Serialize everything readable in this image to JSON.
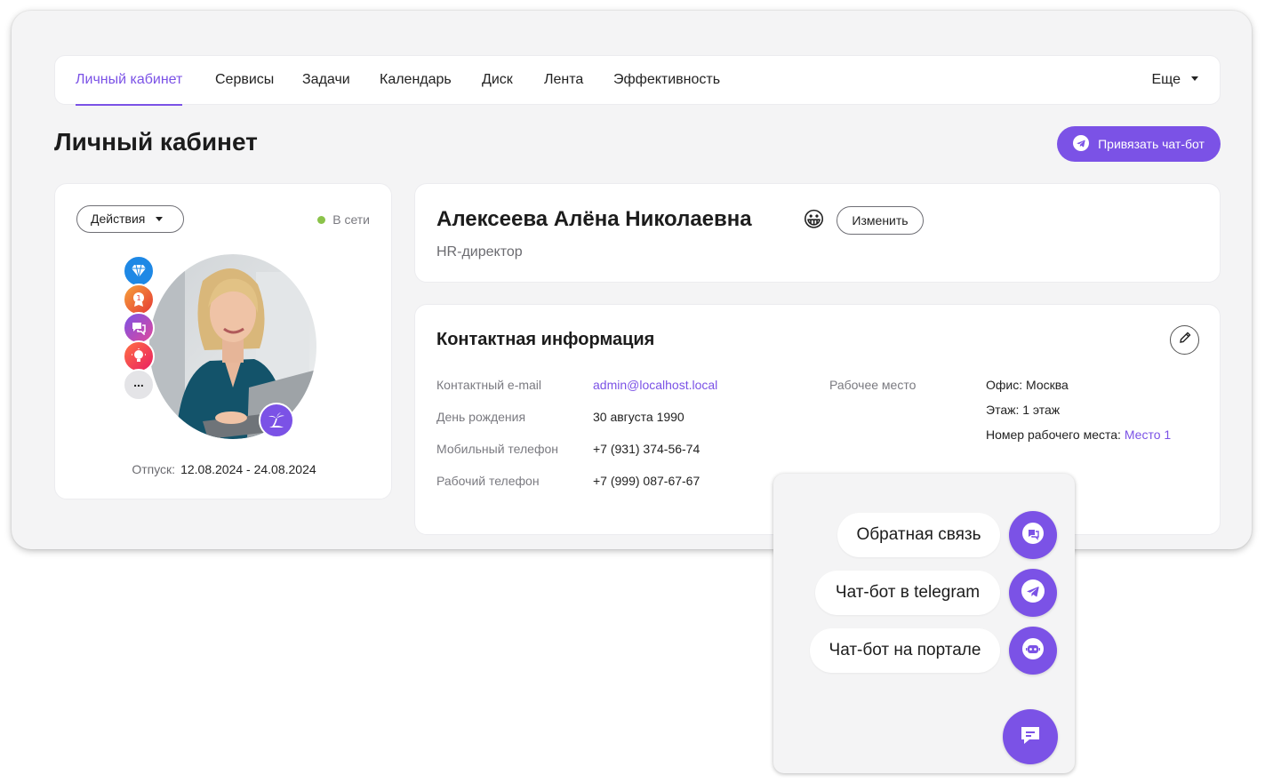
{
  "nav": {
    "items": [
      "Личный кабинет",
      "Сервисы",
      "Задачи",
      "Календарь",
      "Диск",
      "Лента",
      "Эффективность"
    ],
    "active": "Личный кабинет",
    "more_label": "Еще"
  },
  "page": {
    "title": "Личный кабинет",
    "bind_bot_label": "Привязать чат-бот"
  },
  "profile": {
    "actions_label": "Действия",
    "status_text": "В сети",
    "vacation_label": "Отпуск:",
    "vacation_dates": "12.08.2024 - 24.08.2024",
    "badges": [
      "diamond-icon",
      "medal-icon",
      "chat-bubbles-icon",
      "lightbulb-icon",
      "more-icon"
    ],
    "more_badge_text": "..."
  },
  "person": {
    "name": "Алексеева Алёна Николаевна",
    "emoji": "😀",
    "edit_label": "Изменить",
    "job_title": "HR-директор"
  },
  "contact": {
    "title": "Контактная информация",
    "fields": [
      {
        "label": "Контактный e-mail",
        "value": "admin@localhost.local"
      },
      {
        "label": "День рождения",
        "value": "30 августа 1990"
      },
      {
        "label": "Мобильный телефон",
        "value": "+7 (931) 374-56-74"
      },
      {
        "label": "Рабочий телефон",
        "value": "+7 (999) 087-67-67"
      }
    ],
    "workplace_label": "Рабочее место",
    "office": "Офис: Москва",
    "floor": "Этаж: 1 этаж",
    "desk_label": "Номер рабочего места:",
    "desk_value": "Место 1"
  },
  "chat_menu": {
    "items": [
      "Обратная связь",
      "Чат-бот в telegram",
      "Чат-бот на портале"
    ]
  },
  "colors": {
    "accent": "#7b52e6",
    "online": "#8bc34a",
    "background": "#f4f4f5"
  }
}
